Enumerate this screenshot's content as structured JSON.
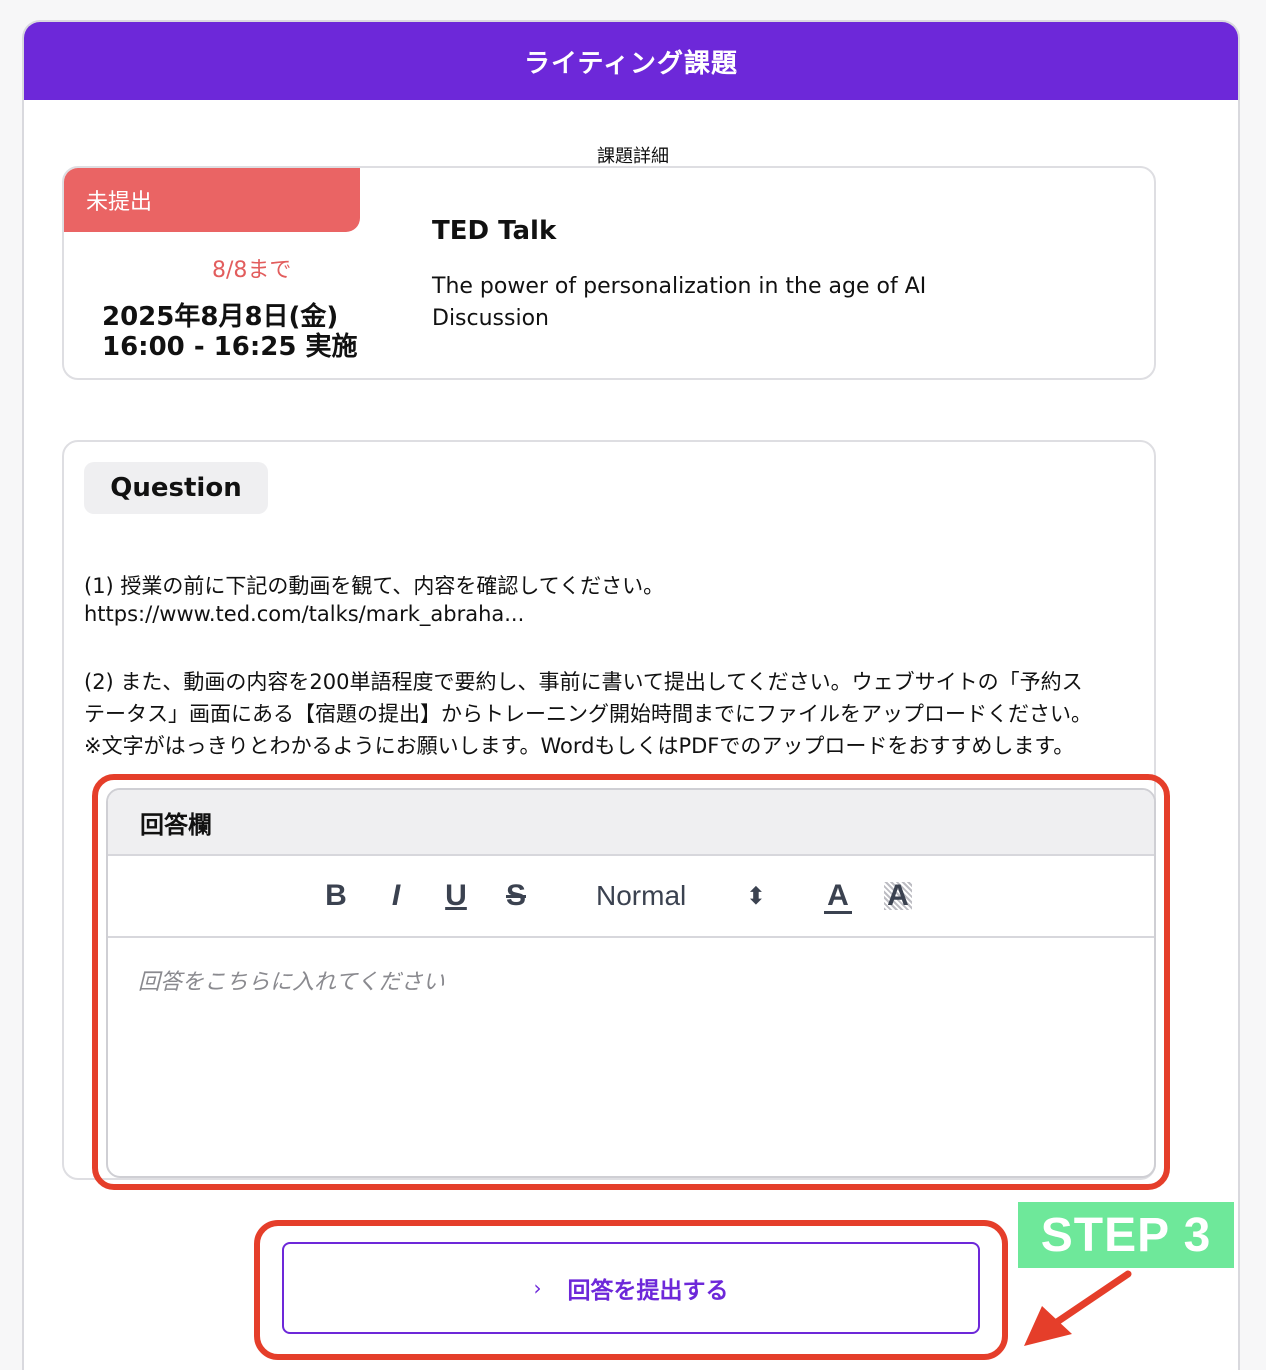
{
  "header": {
    "title": "ライティング課題"
  },
  "section": {
    "label": "課題詳細"
  },
  "task": {
    "status": "未提出",
    "deadline": "8/8まで",
    "date_line1": "2025年8月8日(金)",
    "date_line2": "16:00 - 16:25 実施",
    "title": "TED Talk",
    "desc_line1": "The power of personalization in the age of AI",
    "desc_line2": "Discussion"
  },
  "question": {
    "pill_label": "Question",
    "lines": [
      "(1) 授業の前に下記の動画を観て、内容を確認してください。",
      "https://www.ted.com/talks/mark_abraha...",
      "(2) また、動画の内容を200単語程度で要約し、事前に書いて提出してください。ウェブサイトの「予約ス",
      "テータス」画面にある【宿題の提出】からトレーニング開始時間までにファイルをアップロードください。",
      "※文字がはっきりとわかるようにお願いします。WordもしくはPDFでのアップロードをおすすめします。"
    ]
  },
  "answer": {
    "heading": "回答欄",
    "toolbar": {
      "bold": "B",
      "italic": "I",
      "underline": "U",
      "strike": "S",
      "format_select": "Normal",
      "select_arrows": "⬍",
      "color": "A",
      "background": "A"
    },
    "placeholder": "回答をこちらに入れてください"
  },
  "submit": {
    "chevron": "›",
    "label": "回答を提出する"
  },
  "step": {
    "label": "STEP 3"
  },
  "colors": {
    "brand": "#6d28d9",
    "status": "#ea6464",
    "highlight": "#e53e2a",
    "step": "#6ee89a"
  }
}
